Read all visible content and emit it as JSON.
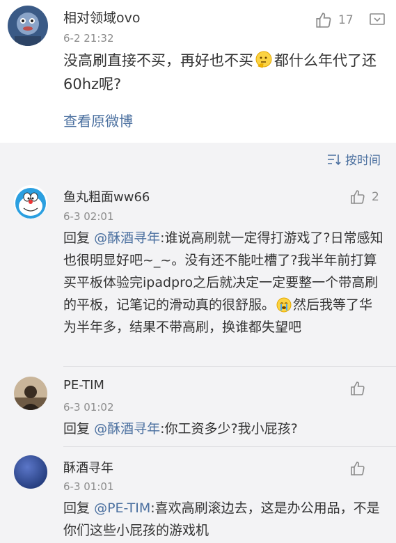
{
  "post": {
    "username": "相对领域ovo",
    "time": "6-2 21:32",
    "likes": "17",
    "text_before": "没高刷直接不买，再好也不买",
    "text_after": "都什么年代了还60hz呢?",
    "emoji": "thinking-face-icon",
    "view_original": "查看原微博"
  },
  "sort": {
    "label": "按时间",
    "icon": "sort-icon"
  },
  "comments": [
    {
      "username": "鱼丸粗面ww66",
      "time": "6-3 02:01",
      "likes": "2",
      "reply_prefix": "回复",
      "mention": "@酥酒寻年",
      "text_before": ":谁说高刷就一定得打游戏了?日常感知也很明显好吧~_~。没有还不能吐槽了?我半年前打算买平板体验完ipadpro之后就决定一定要整一个带高刷的平板，记笔记的滑动真的很舒服。",
      "emoji": "crying-face-icon",
      "text_after": "然后我等了华为半年多，结果不带高刷，换谁都失望吧"
    },
    {
      "username": "PE-TIM",
      "time": "6-3 01:02",
      "likes": "",
      "reply_prefix": "回复",
      "mention": "@酥酒寻年",
      "text_before": ":你工资多少?我小屁孩?"
    },
    {
      "username": "酥酒寻年",
      "time": "6-3 01:01",
      "likes": "",
      "reply_prefix": "回复",
      "mention": "@PE-TIM",
      "text_before": ":喜欢高刷滚边去，这是办公用品，不是你们这些小屁孩的游戏机"
    }
  ],
  "colors": {
    "link": "#4a6f9f",
    "meta": "#8c8c8c",
    "comments_bg": "#f3f3f5"
  }
}
